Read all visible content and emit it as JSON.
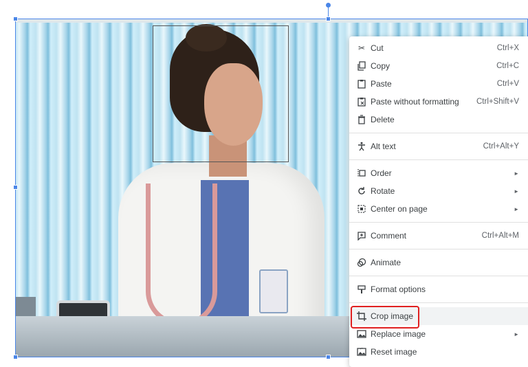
{
  "menu": {
    "items": [
      {
        "label": "Cut",
        "shortcut": "Ctrl+X",
        "icon": "scissors-icon"
      },
      {
        "label": "Copy",
        "shortcut": "Ctrl+C",
        "icon": "copy-icon"
      },
      {
        "label": "Paste",
        "shortcut": "Ctrl+V",
        "icon": "clipboard-icon"
      },
      {
        "label": "Paste without formatting",
        "shortcut": "Ctrl+Shift+V",
        "icon": "clipboard-format-icon"
      },
      {
        "label": "Delete",
        "shortcut": "",
        "icon": "trash-icon"
      },
      {
        "label": "Alt text",
        "shortcut": "Ctrl+Alt+Y",
        "icon": "accessibility-icon"
      },
      {
        "label": "Order",
        "submenu": true,
        "icon": "order-icon"
      },
      {
        "label": "Rotate",
        "submenu": true,
        "icon": "rotate-icon"
      },
      {
        "label": "Center on page",
        "submenu": true,
        "icon": "center-icon"
      },
      {
        "label": "Comment",
        "shortcut": "Ctrl+Alt+M",
        "icon": "comment-icon"
      },
      {
        "label": "Animate",
        "shortcut": "",
        "icon": "animate-icon"
      },
      {
        "label": "Format options",
        "shortcut": "",
        "icon": "format-options-icon"
      },
      {
        "label": "Crop image",
        "shortcut": "",
        "icon": "crop-icon",
        "highlighted": true
      },
      {
        "label": "Replace image",
        "submenu": true,
        "icon": "replace-image-icon"
      },
      {
        "label": "Reset image",
        "shortcut": "",
        "icon": "reset-image-icon"
      }
    ],
    "submenu_arrow": "►"
  },
  "colors": {
    "selection": "#4a86e8",
    "highlight_box": "#e02020",
    "menu_text": "#3c4043"
  }
}
